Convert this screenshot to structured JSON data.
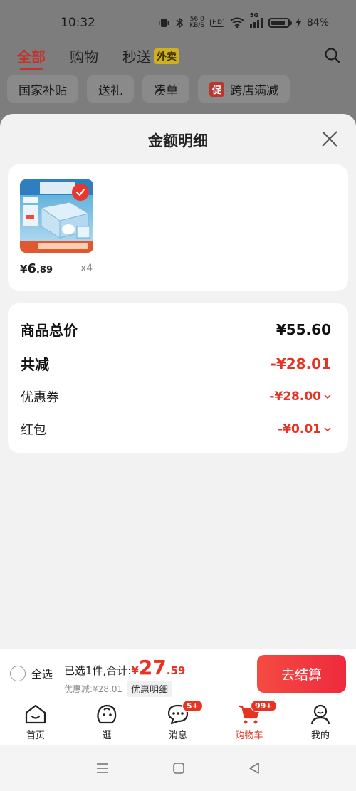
{
  "status_bar": {
    "time": "10:32",
    "net_speed_value": "56.0",
    "net_speed_unit": "KB/S",
    "hd": "HD",
    "signal_label": "5G",
    "battery": "84%",
    "icons": [
      "vibrate-icon",
      "bluetooth-icon",
      "wifi-icon",
      "signal-icon",
      "battery-icon",
      "charging-icon"
    ]
  },
  "top_tabs": [
    {
      "label": "全部",
      "active": true
    },
    {
      "label": "购物",
      "active": false
    },
    {
      "label": "秒送",
      "active": false,
      "badge": "外卖"
    }
  ],
  "filter_chips": [
    "国家补贴",
    "送礼",
    "凑单",
    "跨店满减"
  ],
  "promo_tag": "促",
  "sheet": {
    "title": "金额明细",
    "product": {
      "price_symbol": "¥",
      "price_int": "6",
      "price_dec": ".89",
      "quantity": "x4"
    },
    "summary": {
      "total_label": "商品总价",
      "total_value": "¥55.60",
      "reduce_label": "共减",
      "reduce_value": "-¥28.01",
      "coupon_label": "优惠券",
      "coupon_value": "-¥28.00",
      "redpacket_label": "红包",
      "redpacket_value": "-¥0.01"
    }
  },
  "checkout": {
    "select_all": "全选",
    "selected_text": "已选1件,合计:",
    "total_symbol": "¥",
    "total_int": "27",
    "total_dec": ".59",
    "discount_text": "优惠减:¥28.01",
    "detail_button": "优惠明细",
    "checkout_button": "去结算"
  },
  "bottom_nav": [
    {
      "label": "首页",
      "icon": "home-icon"
    },
    {
      "label": "逛",
      "icon": "browse-icon"
    },
    {
      "label": "消息",
      "icon": "message-icon",
      "badge": "5+"
    },
    {
      "label": "购物车",
      "icon": "cart-icon",
      "badge": "99+",
      "active": true
    },
    {
      "label": "我的",
      "icon": "profile-icon"
    }
  ],
  "colors": {
    "accent": "#e53423",
    "overlay": "#7a7a7a"
  }
}
